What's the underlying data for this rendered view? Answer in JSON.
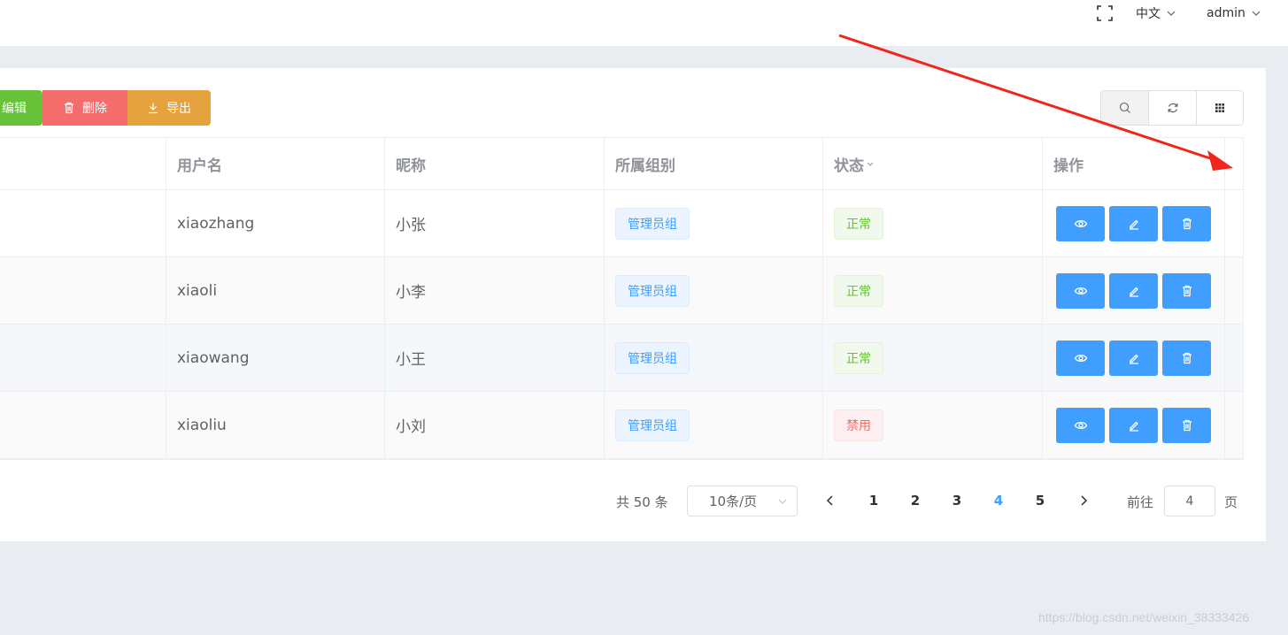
{
  "header": {
    "language": "中文",
    "user": "admin"
  },
  "toolbar": {
    "edit_label": "编辑",
    "delete_label": "删除",
    "export_label": "导出"
  },
  "table": {
    "columns": [
      "",
      "用户名",
      "昵称",
      "所属组别",
      "状态",
      "操作"
    ],
    "rows": [
      {
        "username": "xiaozhang",
        "nickname": "小张",
        "group": "管理员组",
        "status": "正常",
        "status_type": "success"
      },
      {
        "username": "xiaoli",
        "nickname": "小李",
        "group": "管理员组",
        "status": "正常",
        "status_type": "success"
      },
      {
        "username": "xiaowang",
        "nickname": "小王",
        "group": "管理员组",
        "status": "正常",
        "status_type": "success"
      },
      {
        "username": "xiaoliu",
        "nickname": "小刘",
        "group": "管理员组",
        "status": "禁用",
        "status_type": "danger"
      }
    ]
  },
  "pagination": {
    "total": "共 50 条",
    "page_size": "10条/页",
    "pages": [
      "1",
      "2",
      "3",
      "4",
      "5"
    ],
    "current": "4",
    "goto_prefix": "前往",
    "goto_value": "4",
    "goto_suffix": "页"
  },
  "watermark": "https://blog.csdn.net/weixin_38333426",
  "colors": {
    "primary": "#409eff",
    "success": "#67c23a",
    "danger": "#f56c6c",
    "warning": "#e6a23c",
    "annotation": "#f0261c"
  }
}
